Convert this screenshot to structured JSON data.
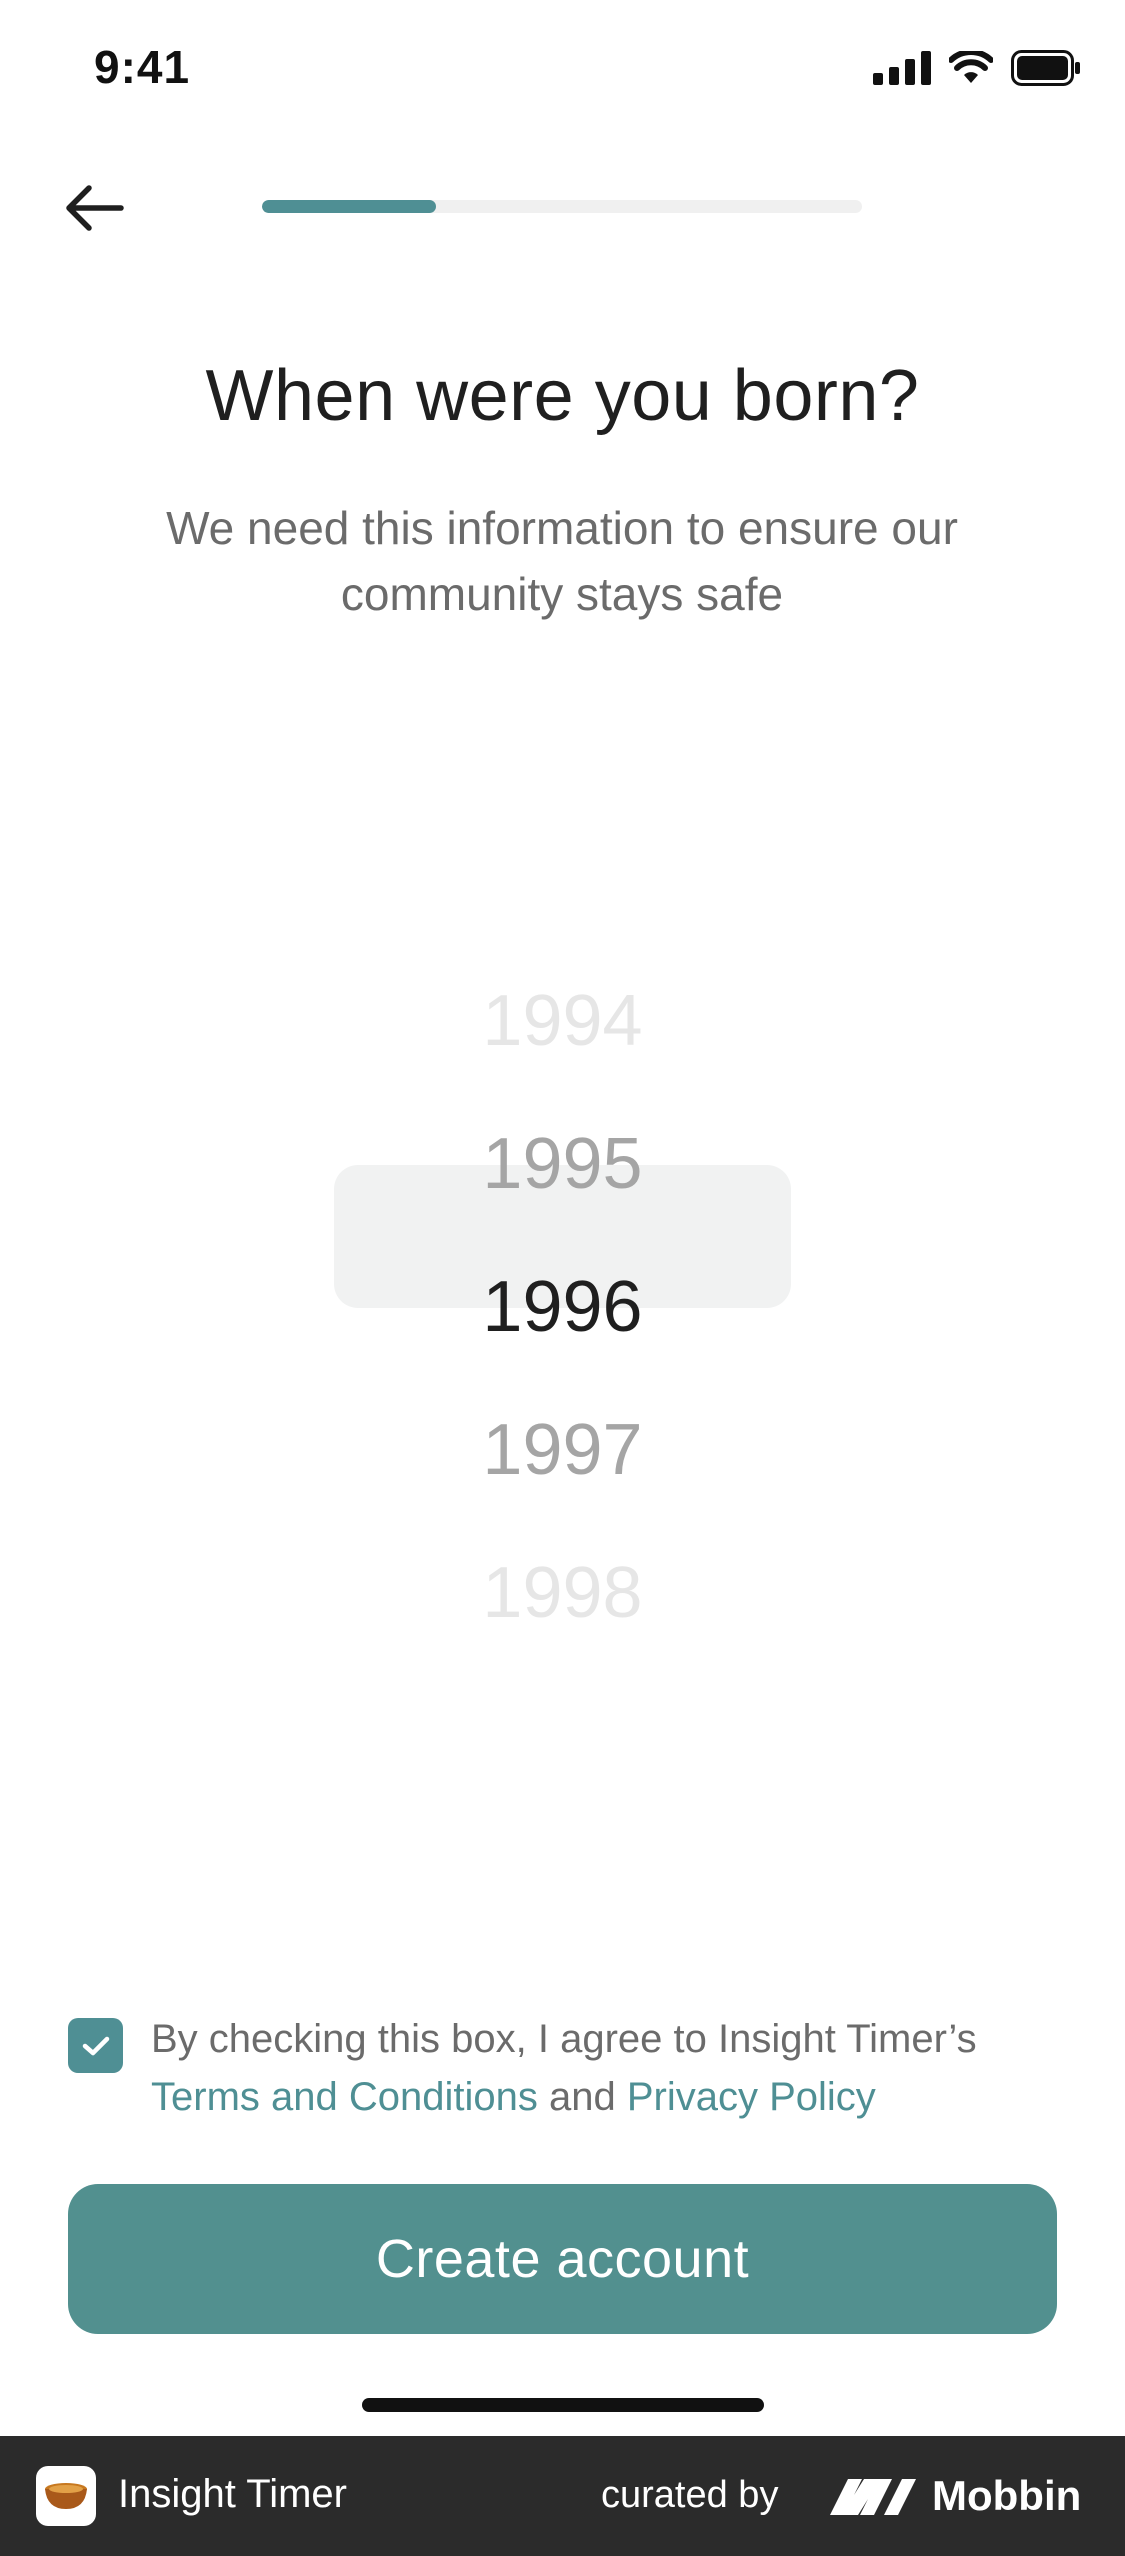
{
  "status_bar": {
    "time": "9:41",
    "icons": [
      "signal-icon",
      "wifi-icon",
      "battery-icon"
    ]
  },
  "header": {
    "back_icon": "arrow-left-icon",
    "progress": 0.29
  },
  "main": {
    "title": "When were you born?",
    "subtitle": "We need this information to ensure our community stays safe"
  },
  "picker": {
    "years": [
      "1994",
      "1995",
      "1996",
      "1997",
      "1998"
    ],
    "selected": "1996"
  },
  "consent": {
    "checked": true,
    "text_prefix": "By checking this box, I agree to Insight Timer’s",
    "terms_label": "Terms and Conditions",
    "and_label": "and",
    "privacy_label": "Privacy Policy"
  },
  "cta": {
    "label": "Create account"
  },
  "footer": {
    "app_name": "Insight Timer",
    "curated_by": "curated by",
    "brand": "Mobbin"
  },
  "colors": {
    "accent": "#4f8f94",
    "button": "#52908f",
    "footer_bg": "#2b2b2b"
  }
}
